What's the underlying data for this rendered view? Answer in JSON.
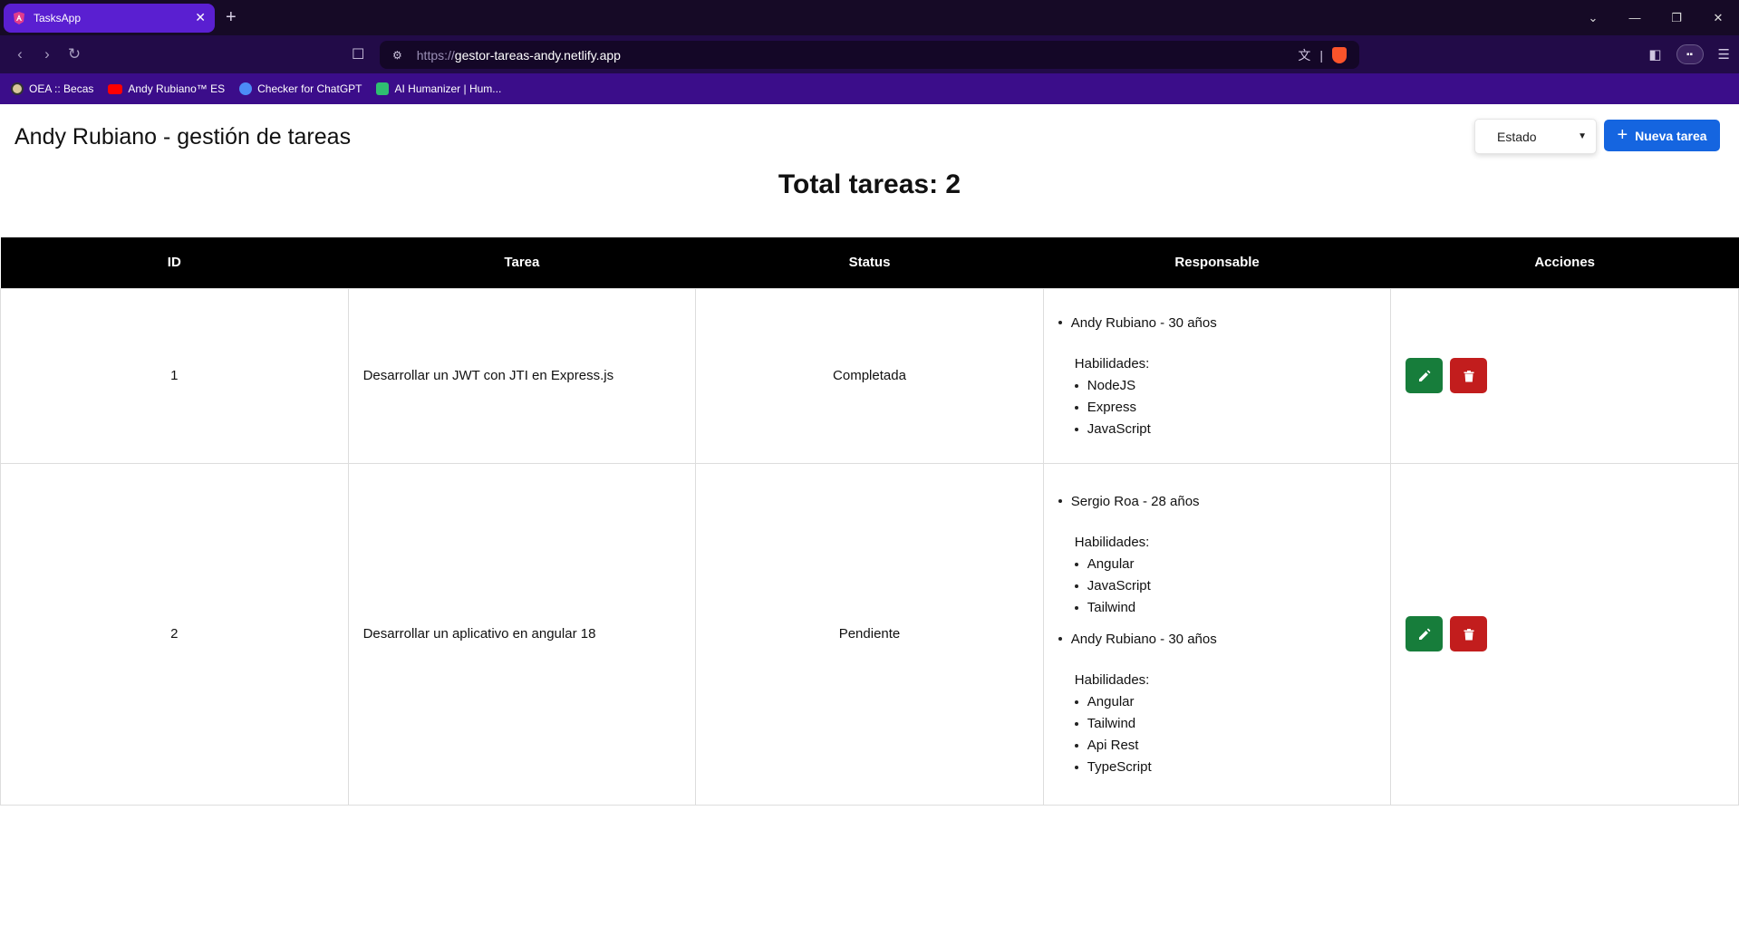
{
  "browser": {
    "tab_title": "TasksApp",
    "tab_close": "✕",
    "new_tab": "+",
    "url_scheme": "https://",
    "url_host": "gestor-tareas-andy.netlify.app",
    "bookmarks": [
      {
        "label": "OEA :: Becas",
        "icon": "oea-icon"
      },
      {
        "label": "Andy Rubiano™ ES",
        "icon": "youtube-icon"
      },
      {
        "label": "Checker for ChatGPT",
        "icon": "checker-icon"
      },
      {
        "label": "AI Humanizer | Hum...",
        "icon": "humanizer-icon"
      }
    ]
  },
  "header": {
    "title": "Andy Rubiano - gestión de tareas",
    "state_select": "Estado",
    "new_task_label": "Nueva tarea"
  },
  "summary": {
    "total": "Total tareas: 2"
  },
  "table": {
    "columns": [
      "ID",
      "Tarea",
      "Status",
      "Responsable",
      "Acciones"
    ],
    "skills_label": "Habilidades:",
    "rows": [
      {
        "id": "1",
        "task": "Desarrollar un JWT con JTI en Express.js",
        "status": "Completada",
        "responsables": [
          {
            "person": "Andy Rubiano - 30 años",
            "skills": [
              "NodeJS",
              "Express",
              "JavaScript"
            ]
          }
        ]
      },
      {
        "id": "2",
        "task": "Desarrollar un aplicativo en angular 18",
        "status": "Pendiente",
        "responsables": [
          {
            "person": "Sergio Roa - 28 años",
            "skills": [
              "Angular",
              "JavaScript",
              "Tailwind"
            ]
          },
          {
            "person": "Andy Rubiano - 30 años",
            "skills": [
              "Angular",
              "Tailwind",
              "Api Rest",
              "TypeScript"
            ]
          }
        ]
      }
    ]
  },
  "colors": {
    "primary": "#1565e0",
    "edit": "#177d3b",
    "delete": "#c21d1d",
    "header_bg": "#000000"
  }
}
